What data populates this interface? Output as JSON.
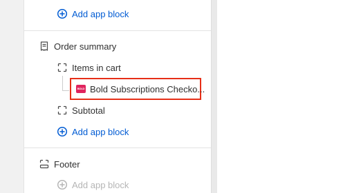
{
  "panel": {
    "add_app_block_top": "Add app block",
    "order_summary": {
      "title": "Order summary",
      "items_in_cart": "Items in cart",
      "app_block_label": "Bold Subscriptions Checko...",
      "app_block_logo_text": "BOLD",
      "subtotal": "Subtotal",
      "add_app_block": "Add app block"
    },
    "footer": {
      "title": "Footer",
      "add_app_block": "Add app block"
    }
  },
  "icons": {
    "add": "plus-circle-icon",
    "order_summary": "receipt-icon",
    "block": "dashed-square-icon",
    "footer": "footer-layout-icon"
  },
  "colors": {
    "link": "#005bd3",
    "highlight_border": "#e62e17",
    "app_logo": "#e0245e"
  }
}
